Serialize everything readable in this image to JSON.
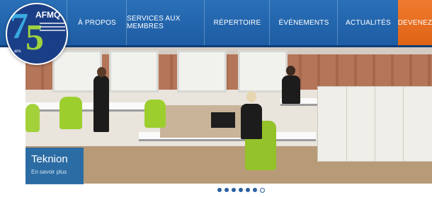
{
  "logo": {
    "number": "75",
    "name": "AFMQ",
    "suffix": "ans"
  },
  "nav": {
    "items": [
      {
        "label": "À propos"
      },
      {
        "label": "Services aux membres"
      },
      {
        "label": "Répertoire"
      },
      {
        "label": "Événements"
      },
      {
        "label": "Actualités"
      },
      {
        "label": "Devenez"
      }
    ]
  },
  "hero": {
    "caption_title": "Teknion",
    "caption_subtitle": "En savoir plus"
  },
  "slider": {
    "dot_count": 7,
    "active_index": 6
  },
  "colors": {
    "nav_blue": "#1d5ca3",
    "nav_accent": "#e66d1f",
    "logo_navy": "#1b3f86",
    "logo_cyan": "#3aa9e0",
    "logo_green": "#9ed13f"
  }
}
